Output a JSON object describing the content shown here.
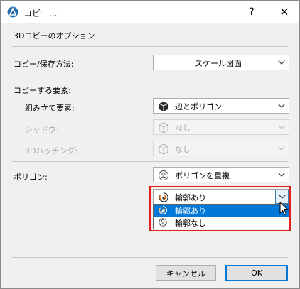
{
  "window": {
    "title": "コピー...",
    "help": "?",
    "close": "✕"
  },
  "options": {
    "section_title": "3Dコピーのオプション"
  },
  "copy_method": {
    "label": "コピー/保存方法:",
    "value": "スケール図面"
  },
  "elements": {
    "title": "コピーする要素:",
    "assembly": {
      "label": "組み立て要素:",
      "value": "辺とポリゴン",
      "icon": "cube-icon"
    },
    "shadow": {
      "label": "シャドウ:",
      "value": "なし",
      "icon": "cube-outline-icon"
    },
    "hatching": {
      "label": "3Dハッチング:",
      "value": "なし",
      "icon": "cube-outline-icon"
    }
  },
  "polygon": {
    "label": "ポリゴン:",
    "mode": {
      "value": "ポリゴンを重複",
      "icon": "outline-polygon-icon"
    },
    "contour": {
      "value": "輪郭あり",
      "options": [
        {
          "label": "輪郭あり",
          "icon": "contour-on-icon",
          "selected": true
        },
        {
          "label": "輪郭なし",
          "icon": "contour-off-icon",
          "selected": false
        }
      ]
    }
  },
  "buttons": {
    "cancel": "キャンセル",
    "ok": "OK"
  },
  "colors": {
    "accent": "#0078d7",
    "highlight_frame": "#e0201e"
  }
}
